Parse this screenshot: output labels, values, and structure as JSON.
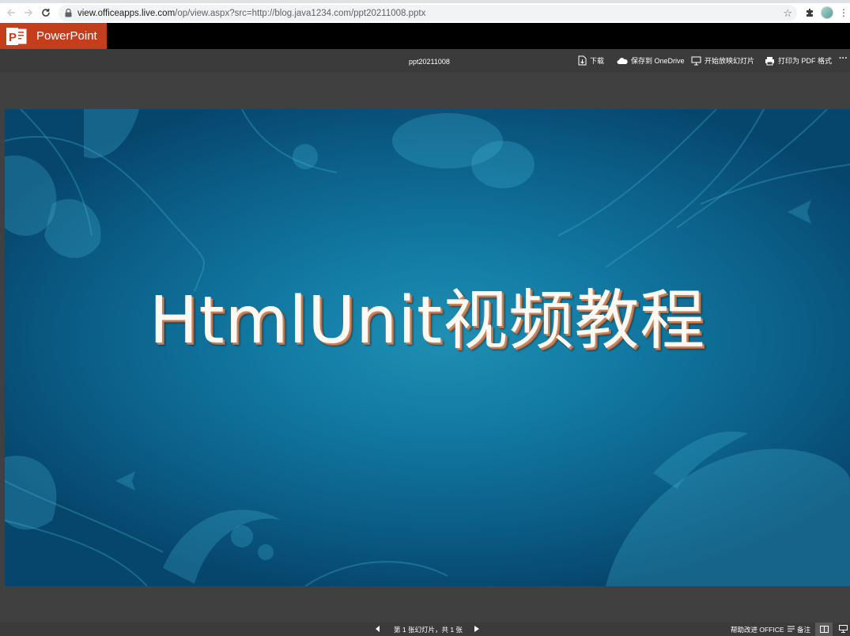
{
  "browser": {
    "url_domain": "view.officeapps.live.com",
    "url_path": "/op/view.aspx?src=http://blog.java1234.com/ppt20211008.pptx"
  },
  "app": {
    "name": "PowerPoint",
    "brand_color": "#c43e1c",
    "logo_letter": "P"
  },
  "commands": {
    "doc_title": "ppt20211008",
    "download": "下载",
    "save_onedrive": "保存到 OneDrive",
    "start_slideshow": "开始放映幻灯片",
    "print_pdf": "打印为 PDF 格式",
    "more": "···"
  },
  "slide": {
    "title": "HtmlUnit视频教程"
  },
  "status": {
    "slide_counter": "第 1 张幻灯片，共 1 张",
    "help_improve": "帮助改进 OFFICE",
    "notes": "备注"
  }
}
